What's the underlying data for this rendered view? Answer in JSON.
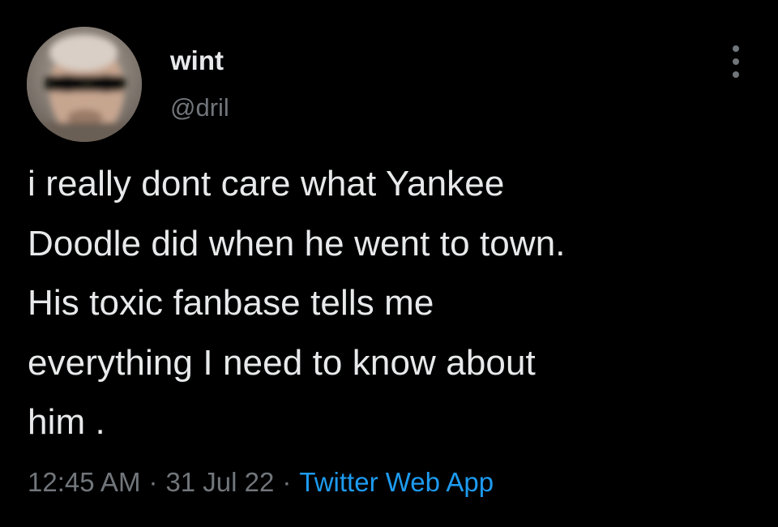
{
  "author": {
    "display_name": "wint",
    "handle": "@dril"
  },
  "more_icon": "more-vertical-icon",
  "tweet": {
    "lines": [
      "i really dont care what Yankee",
      "Doodle did when he went to town.",
      "His toxic fanbase tells me",
      "everything I need to know about",
      "him ."
    ]
  },
  "meta": {
    "time": "12:45 AM",
    "separator": "·",
    "date": "31 Jul 22",
    "source": "Twitter Web App"
  },
  "colors": {
    "background": "#000000",
    "text": "#e7e9ea",
    "secondary": "#71767b",
    "link": "#1d9bf0"
  }
}
